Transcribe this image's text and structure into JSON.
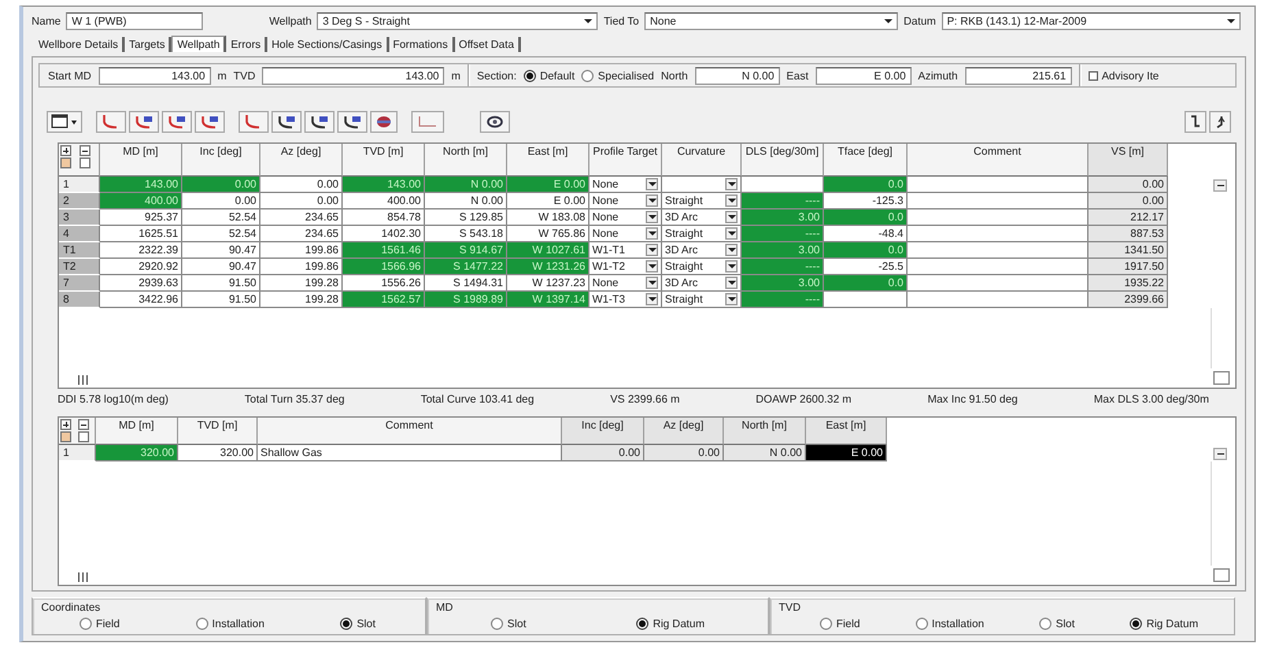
{
  "header": {
    "name_label": "Name",
    "name": "W 1 (PWB)",
    "wellpath_label": "Wellpath",
    "wellpath": "3 Deg S - Straight",
    "tied_to_label": "Tied To",
    "tied_to": "None",
    "datum_label": "Datum",
    "datum": "P: RKB (143.1) 12-Mar-2009"
  },
  "tabs": [
    {
      "label": "Wellbore Details",
      "selected": false
    },
    {
      "label": "Targets",
      "selected": false
    },
    {
      "label": "Wellpath",
      "selected": true
    },
    {
      "label": "Errors",
      "selected": false
    },
    {
      "label": "Hole Sections/Casings",
      "selected": false
    },
    {
      "label": "Formations",
      "selected": false
    },
    {
      "label": "Offset Data",
      "selected": false
    }
  ],
  "start": {
    "start_md_label": "Start MD",
    "start_md": "143.00",
    "md_unit": "m",
    "tvd_label": "TVD",
    "tvd": "143.00",
    "tvd_unit": "m",
    "section_label": "Section:",
    "section_options": [
      {
        "label": "Default",
        "selected": true
      },
      {
        "label": "Specialised",
        "selected": false
      }
    ],
    "north_label": "North",
    "north": "N 0.00",
    "east_label": "East",
    "east": "E 0.00",
    "azimuth_label": "Azimuth",
    "azimuth": "215.61",
    "advisory": {
      "label": "Advisory Ite",
      "checked": false
    }
  },
  "wellpath_table": {
    "columns": [
      {
        "label": "MD [m]",
        "kind": "number",
        "readonly": false
      },
      {
        "label": "Inc [deg]",
        "kind": "number",
        "readonly": false
      },
      {
        "label": "Az [deg]",
        "kind": "number",
        "readonly": false
      },
      {
        "label": "TVD [m]",
        "kind": "number",
        "readonly": false
      },
      {
        "label": "North [m]",
        "kind": "number",
        "readonly": false
      },
      {
        "label": "East [m]",
        "kind": "number",
        "readonly": false
      },
      {
        "label": "Profile Target",
        "kind": "dropdown",
        "readonly": false
      },
      {
        "label": "Curvature",
        "kind": "dropdown",
        "readonly": false
      },
      {
        "label": "DLS [deg/30m]",
        "kind": "number",
        "readonly": false
      },
      {
        "label": "Tface [deg]",
        "kind": "number",
        "readonly": false
      },
      {
        "label": "Comment",
        "kind": "text",
        "readonly": false
      },
      {
        "label": "VS [m]",
        "kind": "number",
        "readonly": true
      }
    ],
    "rows": [
      {
        "label": "1",
        "cells": [
          {
            "text": "143.00",
            "locked": true
          },
          {
            "text": "0.00",
            "locked": true
          },
          {
            "text": "0.00",
            "locked": false
          },
          {
            "text": "143.00",
            "locked": true
          },
          {
            "text": "N 0.00",
            "locked": true
          },
          {
            "text": "E 0.00",
            "locked": true
          },
          {
            "text": "None",
            "locked": false
          },
          {
            "locked": false
          },
          {
            "locked": false
          },
          {
            "text": "0.0",
            "locked": true
          },
          {
            "locked": false
          },
          {
            "text": "0.00",
            "locked": false
          }
        ]
      },
      {
        "label": "2",
        "cells": [
          {
            "text": "400.00",
            "locked": true
          },
          {
            "text": "0.00",
            "locked": false
          },
          {
            "text": "0.00",
            "locked": false
          },
          {
            "text": "400.00",
            "locked": false
          },
          {
            "text": "N 0.00",
            "locked": false
          },
          {
            "text": "E 0.00",
            "locked": false
          },
          {
            "text": "None",
            "locked": false
          },
          {
            "text": "Straight",
            "locked": false
          },
          {
            "text": "----",
            "locked": true
          },
          {
            "text": "-125.3",
            "locked": false
          },
          {
            "locked": false
          },
          {
            "text": "0.00",
            "locked": false
          }
        ]
      },
      {
        "label": "3",
        "cells": [
          {
            "text": "925.37",
            "locked": false
          },
          {
            "text": "52.54",
            "locked": false
          },
          {
            "text": "234.65",
            "locked": false
          },
          {
            "text": "854.78",
            "locked": false
          },
          {
            "text": "S 129.85",
            "locked": false
          },
          {
            "text": "W 183.08",
            "locked": false
          },
          {
            "text": "None",
            "locked": false
          },
          {
            "text": "3D Arc",
            "locked": false
          },
          {
            "text": "3.00",
            "locked": true
          },
          {
            "text": "0.0",
            "locked": true
          },
          {
            "locked": false
          },
          {
            "text": "212.17",
            "locked": false
          }
        ]
      },
      {
        "label": "4",
        "cells": [
          {
            "text": "1625.51",
            "locked": false
          },
          {
            "text": "52.54",
            "locked": false
          },
          {
            "text": "234.65",
            "locked": false
          },
          {
            "text": "1402.30",
            "locked": false
          },
          {
            "text": "S 543.18",
            "locked": false
          },
          {
            "text": "W 765.86",
            "locked": false
          },
          {
            "text": "None",
            "locked": false
          },
          {
            "text": "Straight",
            "locked": false
          },
          {
            "text": "----",
            "locked": true
          },
          {
            "text": "-48.4",
            "locked": false
          },
          {
            "locked": false
          },
          {
            "text": "887.53",
            "locked": false
          }
        ]
      },
      {
        "label": "T1",
        "cells": [
          {
            "text": "2322.39",
            "locked": false
          },
          {
            "text": "90.47",
            "locked": false
          },
          {
            "text": "199.86",
            "locked": false
          },
          {
            "text": "1561.46",
            "locked": true
          },
          {
            "text": "S 914.67",
            "locked": true
          },
          {
            "text": "W 1027.61",
            "locked": true
          },
          {
            "text": "W1-T1",
            "locked": false
          },
          {
            "text": "3D Arc",
            "locked": false
          },
          {
            "text": "3.00",
            "locked": true
          },
          {
            "text": "0.0",
            "locked": true
          },
          {
            "locked": false
          },
          {
            "text": "1341.50",
            "locked": false
          }
        ]
      },
      {
        "label": "T2",
        "cells": [
          {
            "text": "2920.92",
            "locked": false
          },
          {
            "text": "90.47",
            "locked": false
          },
          {
            "text": "199.86",
            "locked": false
          },
          {
            "text": "1566.96",
            "locked": true
          },
          {
            "text": "S 1477.22",
            "locked": true
          },
          {
            "text": "W 1231.26",
            "locked": true
          },
          {
            "text": "W1-T2",
            "locked": false
          },
          {
            "text": "Straight",
            "locked": false
          },
          {
            "text": "----",
            "locked": true
          },
          {
            "text": "-25.5",
            "locked": false
          },
          {
            "locked": false
          },
          {
            "text": "1917.50",
            "locked": false
          }
        ]
      },
      {
        "label": "7",
        "cells": [
          {
            "text": "2939.63",
            "locked": false
          },
          {
            "text": "91.50",
            "locked": false
          },
          {
            "text": "199.28",
            "locked": false
          },
          {
            "text": "1556.26",
            "locked": false
          },
          {
            "text": "S 1494.31",
            "locked": false
          },
          {
            "text": "W 1237.23",
            "locked": false
          },
          {
            "text": "None",
            "locked": false
          },
          {
            "text": "3D Arc",
            "locked": false
          },
          {
            "text": "3.00",
            "locked": true
          },
          {
            "text": "0.0",
            "locked": true
          },
          {
            "locked": false
          },
          {
            "text": "1935.22",
            "locked": false
          }
        ]
      },
      {
        "label": "8",
        "cells": [
          {
            "text": "3422.96",
            "locked": false
          },
          {
            "text": "91.50",
            "locked": false
          },
          {
            "text": "199.28",
            "locked": false
          },
          {
            "text": "1562.57",
            "locked": true
          },
          {
            "text": "S 1989.89",
            "locked": true
          },
          {
            "text": "W 1397.14",
            "locked": true
          },
          {
            "text": "W1-T3",
            "locked": false
          },
          {
            "text": "Straight",
            "locked": false
          },
          {
            "text": "----",
            "locked": true
          },
          {
            "locked": false
          },
          {
            "locked": false
          },
          {
            "text": "2399.66",
            "locked": false
          }
        ]
      }
    ]
  },
  "summary": [
    "DDI 5.78 log10(m deg)",
    "Total Turn 35.37 deg",
    "Total Curve 103.41 deg",
    "VS 2399.66 m",
    "DOAWP 2600.32 m",
    "Max Inc 91.50 deg",
    "Max DLS 3.00 deg/30m"
  ],
  "markers_table": {
    "columns": [
      {
        "label": "MD [m]",
        "kind": "number",
        "readonly": false
      },
      {
        "label": "TVD [m]",
        "kind": "number",
        "readonly": false
      },
      {
        "label": "Comment",
        "kind": "text",
        "readonly": false
      },
      {
        "label": "Inc [deg]",
        "kind": "number",
        "readonly": true
      },
      {
        "label": "Az [deg]",
        "kind": "number",
        "readonly": true
      },
      {
        "label": "North [m]",
        "kind": "number",
        "readonly": true
      },
      {
        "label": "East [m]",
        "kind": "number",
        "readonly": true
      }
    ],
    "rows": [
      {
        "label": "1",
        "cells": [
          {
            "text": "320.00",
            "locked": true,
            "selected": false
          },
          {
            "text": "320.00",
            "locked": false,
            "selected": false
          },
          {
            "text": "Shallow Gas",
            "locked": false,
            "selected": false
          },
          {
            "text": "0.00",
            "locked": false,
            "selected": false
          },
          {
            "text": "0.00",
            "locked": false,
            "selected": false
          },
          {
            "text": "N 0.00",
            "locked": false,
            "selected": false
          },
          {
            "text": "E 0.00",
            "locked": false,
            "selected": true
          }
        ]
      }
    ]
  },
  "reference_groups": [
    {
      "title": "Coordinates",
      "options": [
        {
          "label": "Field",
          "selected": false
        },
        {
          "label": "Installation",
          "selected": false
        },
        {
          "label": "Slot",
          "selected": true
        }
      ]
    },
    {
      "title": "MD",
      "options": [
        {
          "label": "Slot",
          "selected": false
        },
        {
          "label": "Rig Datum",
          "selected": true
        }
      ]
    },
    {
      "title": "TVD",
      "options": [
        {
          "label": "Field",
          "selected": false
        },
        {
          "label": "Installation",
          "selected": false
        },
        {
          "label": "Slot",
          "selected": false
        },
        {
          "label": "Rig Datum",
          "selected": true
        }
      ]
    }
  ]
}
